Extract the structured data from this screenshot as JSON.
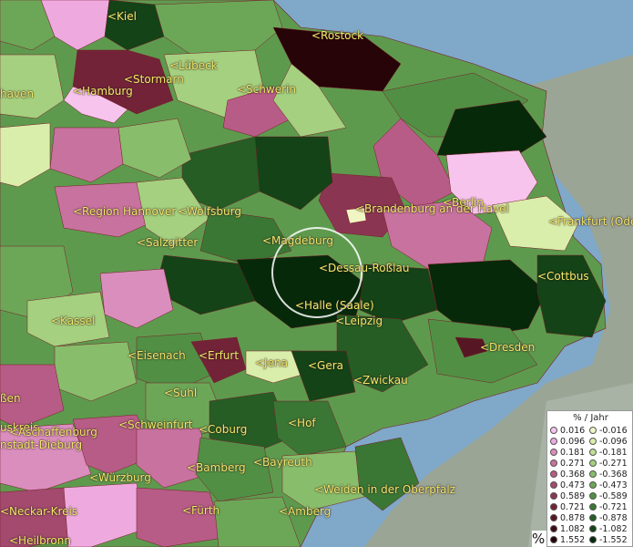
{
  "colors": {
    "sea": "#7fa8c9",
    "relief": "#9aa596",
    "label": "#f2e96a"
  },
  "places": [
    {
      "id": "kiel",
      "label": "<Kiel"
    },
    {
      "id": "rostock",
      "label": "<Rostock"
    },
    {
      "id": "stormarn",
      "label": "<Stormarn"
    },
    {
      "id": "luebeck",
      "label": "<Lübeck"
    },
    {
      "id": "hamburg",
      "label": "<Hamburg"
    },
    {
      "id": "schwerin",
      "label": "<Schwerin"
    },
    {
      "id": "haven",
      "label": "haven"
    },
    {
      "id": "berlin",
      "label": "<Berlin"
    },
    {
      "id": "brandenburg",
      "label": "<Brandenburg an der Havel"
    },
    {
      "id": "frankfurt-oder",
      "label": "<Frankfurt (Ode"
    },
    {
      "id": "region-hannover",
      "label": "<Region Hannover"
    },
    {
      "id": "wolfsburg",
      "label": "<Wolfsburg"
    },
    {
      "id": "salzgitter",
      "label": "<Salzgitter"
    },
    {
      "id": "magdeburg",
      "label": "<Magdeburg"
    },
    {
      "id": "dessau",
      "label": "<Dessau-Roßlau"
    },
    {
      "id": "cottbus",
      "label": "<Cottbus"
    },
    {
      "id": "halle",
      "label": "<Halle (Saale)"
    },
    {
      "id": "leipzig",
      "label": "<Leipzig"
    },
    {
      "id": "kassel",
      "label": "<Kassel"
    },
    {
      "id": "dresden",
      "label": "<Dresden"
    },
    {
      "id": "eisenach",
      "label": "<Eisenach"
    },
    {
      "id": "erfurt",
      "label": "<Erfurt"
    },
    {
      "id": "jena",
      "label": "<Jena"
    },
    {
      "id": "gera",
      "label": "<Gera"
    },
    {
      "id": "zwickau",
      "label": "<Zwickau"
    },
    {
      "id": "suhl",
      "label": "<Suhl"
    },
    {
      "id": "ssen",
      "label": "ßen"
    },
    {
      "id": "hof",
      "label": "<Hof"
    },
    {
      "id": "kreis",
      "label": "uskreis"
    },
    {
      "id": "coburg",
      "label": "<Coburg"
    },
    {
      "id": "schweinfurt",
      "label": "<Schweinfurt"
    },
    {
      "id": "aschaffenburg",
      "label": "<Aschaffenburg"
    },
    {
      "id": "bayreuth",
      "label": "<Bayreuth"
    },
    {
      "id": "dieburg",
      "label": "nstadt-Dieburg"
    },
    {
      "id": "bamberg",
      "label": "<Bamberg"
    },
    {
      "id": "wuerzburg",
      "label": "<Würzburg"
    },
    {
      "id": "weiden",
      "label": "<Weiden in der Oberpfalz"
    },
    {
      "id": "neckar",
      "label": "<Neckar-Kreis"
    },
    {
      "id": "fuerth",
      "label": "<Fürth"
    },
    {
      "id": "amberg",
      "label": "<Amberg"
    },
    {
      "id": "heilbronn",
      "label": "<Heilbronn"
    }
  ],
  "legend": {
    "title": "% / Jahr",
    "positive": [
      {
        "value": "0.016",
        "color": "#f7c4ee"
      },
      {
        "value": "0.096",
        "color": "#eeaadf"
      },
      {
        "value": "0.181",
        "color": "#d98ebd"
      },
      {
        "value": "0.271",
        "color": "#c8729f"
      },
      {
        "value": "0.368",
        "color": "#b75c86"
      },
      {
        "value": "0.473",
        "color": "#a34a6e"
      },
      {
        "value": "0.589",
        "color": "#8a3552"
      },
      {
        "value": "0.721",
        "color": "#722337"
      },
      {
        "value": "0.878",
        "color": "#571623"
      },
      {
        "value": "1.082",
        "color": "#3e0b14"
      },
      {
        "value": "1.552",
        "color": "#270408"
      }
    ],
    "negative": [
      {
        "value": "-0.016",
        "color": "#f0f5c4"
      },
      {
        "value": "-0.096",
        "color": "#d9eeaa"
      },
      {
        "value": "-0.181",
        "color": "#bfe094"
      },
      {
        "value": "-0.271",
        "color": "#a4d07f"
      },
      {
        "value": "-0.368",
        "color": "#88bd6b"
      },
      {
        "value": "-0.473",
        "color": "#6ca758"
      },
      {
        "value": "-0.589",
        "color": "#518f45"
      },
      {
        "value": "-0.721",
        "color": "#3a7634"
      },
      {
        "value": "-0.878",
        "color": "#255d25"
      },
      {
        "value": "-1.082",
        "color": "#134316"
      },
      {
        "value": "-1.552",
        "color": "#06290a"
      }
    ]
  },
  "pct_label": "%"
}
